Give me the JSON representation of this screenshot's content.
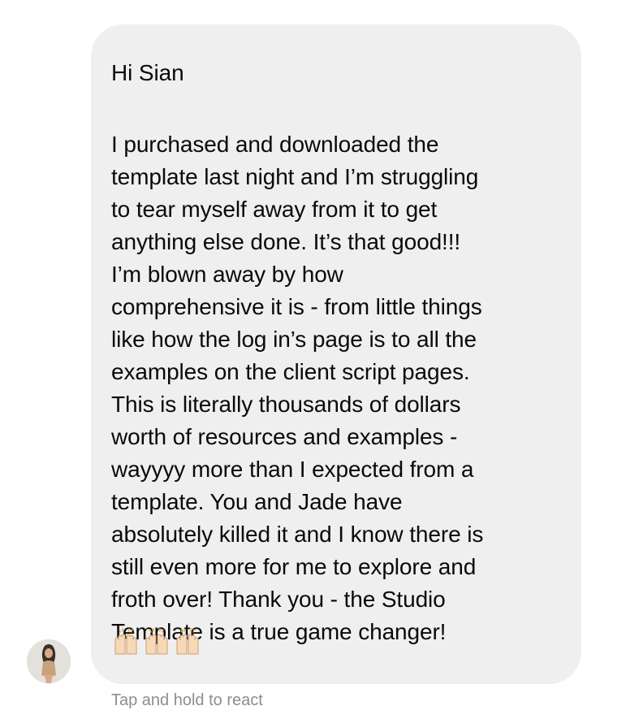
{
  "message": {
    "greeting": "Hi Sian",
    "lines": [
      "I purchased and downloaded the",
      "template last night and I’m struggling",
      "to tear myself away from it to get",
      "anything else done. It’s that good!!!",
      "I’m blown away by how",
      "comprehensive it is - from little things",
      "like how the log in’s page is to all the",
      "examples on the client script pages.",
      "This is literally thousands of dollars",
      "worth of resources and examples -",
      "wayyyy more than I expected from a",
      "template. You and Jade have",
      "absolutely killed it and I know there is",
      "still even more for me to explore and",
      "froth over! Thank you - the Studio",
      "Template is a true game changer!"
    ],
    "emojis": [
      "raising-hands-icon",
      "raising-hands-icon",
      "raising-hands-icon"
    ]
  },
  "footer": {
    "hint": "Tap and hold to react"
  },
  "colors": {
    "bubble": "#efefef",
    "text": "#0a0a0a",
    "hint": "#8e8e8e",
    "emoji_skin": "#f7d9b8"
  }
}
